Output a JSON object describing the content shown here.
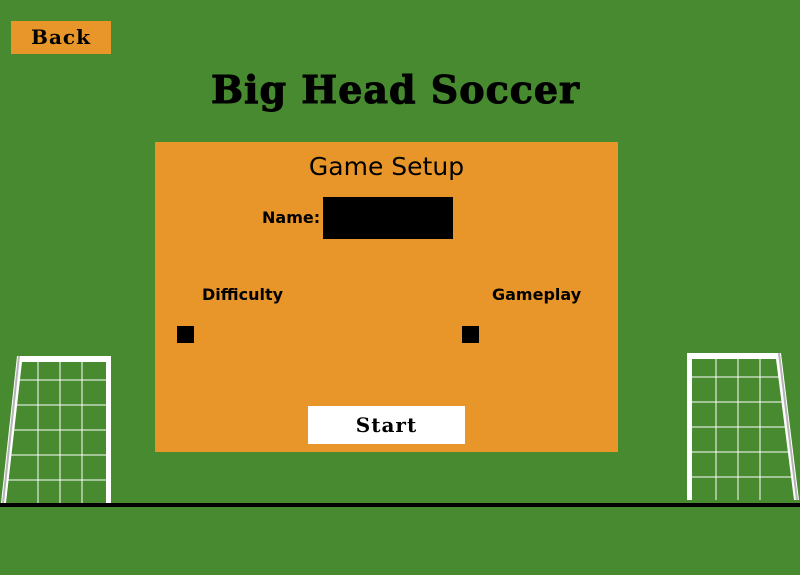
{
  "header": {
    "back_label": "Back",
    "title": "Big Head Soccer"
  },
  "setup": {
    "title": "Game Setup",
    "name_label": "Name:",
    "name_value": "",
    "difficulty_label": "Difficulty",
    "difficulty_checked": false,
    "gameplay_label": "Gameplay",
    "gameplay_checked": false,
    "start_label": "Start"
  },
  "colors": {
    "field": "#478a2f",
    "accent": "#e8962a",
    "goal_frame": "#ffffff",
    "goal_side": "#b5b5b5",
    "ground_line": "#000000"
  }
}
